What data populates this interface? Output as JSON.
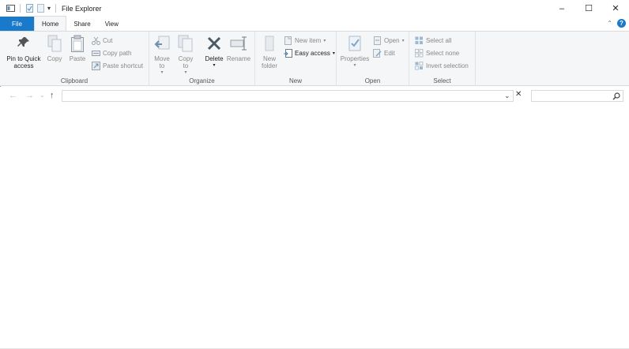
{
  "window": {
    "title": "File Explorer",
    "controls": {
      "minimize": "–",
      "maximize": "☐",
      "close": "✕"
    }
  },
  "quick_access_toolbar": {
    "dropdown": "▾"
  },
  "tabs": {
    "file": "File",
    "home": "Home",
    "share": "Share",
    "view": "View"
  },
  "ribbon": {
    "clipboard": {
      "label": "Clipboard",
      "pin": "Pin to Quick access",
      "copy": "Copy",
      "paste": "Paste",
      "cut": "Cut",
      "copy_path": "Copy path",
      "paste_shortcut": "Paste shortcut"
    },
    "organize": {
      "label": "Organize",
      "move_to": "Move to",
      "copy_to": "Copy to",
      "delete": "Delete",
      "rename": "Rename"
    },
    "new": {
      "label": "New",
      "new_folder": "New folder",
      "new_item": "New item",
      "easy_access": "Easy access"
    },
    "open": {
      "label": "Open",
      "properties": "Properties",
      "open": "Open",
      "edit": "Edit"
    },
    "select": {
      "label": "Select",
      "select_all": "Select all",
      "select_none": "Select none",
      "invert_selection": "Invert selection"
    }
  },
  "navigation": {
    "back": "←",
    "forward": "→",
    "recent": "⌄",
    "up": "↑",
    "address_value": "",
    "search_value": ""
  },
  "colors": {
    "accent": "#1979ca",
    "ribbon_bg": "#f5f6f7",
    "disabled_text": "#888888"
  }
}
